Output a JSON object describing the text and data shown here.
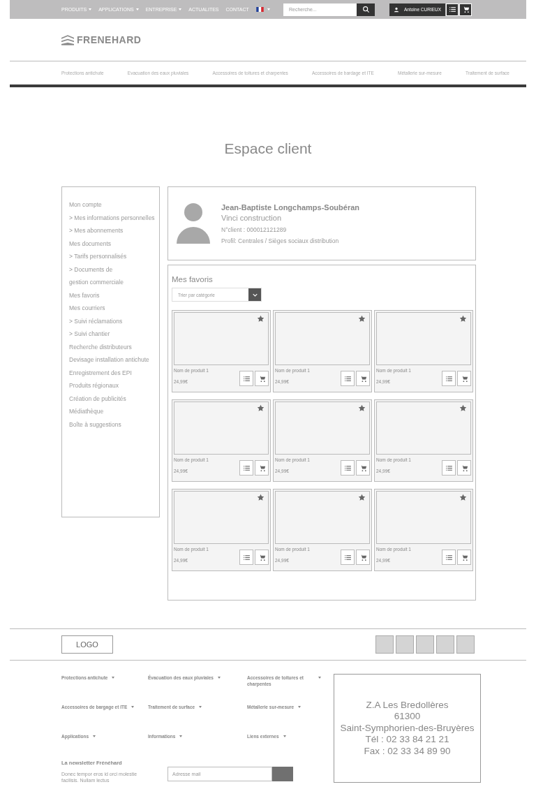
{
  "topbar": {
    "nav": [
      {
        "label": "PRODUITS",
        "dropdown": true
      },
      {
        "label": "APPLICATIONS",
        "dropdown": true
      },
      {
        "label": "ENTREPRISE",
        "dropdown": true
      },
      {
        "label": "ACTUALITES",
        "dropdown": false
      },
      {
        "label": "CONTACT",
        "dropdown": false
      }
    ],
    "search": {
      "placeholder": "Recherche..."
    },
    "user": {
      "name": "Antoine CURIEUX"
    }
  },
  "logo": {
    "text": "FRENEHARD"
  },
  "categories": [
    "Protections antichute",
    "Evacuation des eaux pluviales",
    "Accessoires de toitures et charpentes",
    "Accessoires de bardage et ITE",
    "Métallerie sur-mesure",
    "Traitement de surface"
  ],
  "page_title": "Espace client",
  "sidebar": {
    "items": [
      "Mon compte",
      "> Mes informations personnelles",
      "> Mes abonnements",
      "Mes documents",
      "> Tarifs personnalisés",
      "> Documents de",
      " gestion commerciale",
      "Mes favoris",
      "Mes courriers",
      "> Suivi réclamations",
      "> Suivi chantier",
      "Recherche distributeurs",
      "Devisage installation antichute",
      "Enregistrement des EPI",
      "Produits régionaux",
      "Création de publicités",
      "Médiathèque",
      "Boîte à suggestions"
    ]
  },
  "profile": {
    "name": "Jean-Baptiste Longchamps-Soubéran",
    "company": "Vinci construction",
    "client_number": "N°client : 000012121289",
    "profile": "Profil: Centrales / Sièges sociaux distribution"
  },
  "favorites": {
    "title": "Mes favoris",
    "sort": {
      "placeholder": "Trier par catégorie"
    },
    "products": [
      {
        "name": "Nom de produit 1",
        "price": "24,99€",
        "favorite": true
      },
      {
        "name": "Nom de produit 1",
        "price": "24,99€",
        "favorite": true
      },
      {
        "name": "Nom de produit 1",
        "price": "24,99€",
        "favorite": true
      },
      {
        "name": "Nom de produit 1",
        "price": "24,99€",
        "favorite": true
      },
      {
        "name": "Nom de produit 1",
        "price": "24,99€",
        "favorite": true
      },
      {
        "name": "Nom de produit 1",
        "price": "24,99€",
        "favorite": true
      },
      {
        "name": "Nom de produit 1",
        "price": "24,99€",
        "favorite": true
      },
      {
        "name": "Nom de produit 1",
        "price": "24,99€",
        "favorite": true
      },
      {
        "name": "Nom de produit 1",
        "price": "24,99€",
        "favorite": true
      }
    ]
  },
  "footer": {
    "logo": "LOGO",
    "links": [
      "Protections antichute",
      "Évacuation des eaux pluviales",
      "Accessoires de toitures et charpentes",
      "Accessoires de bargage et ITE",
      "Traitement de surface",
      "Métallerie sur-mesure",
      "Applications",
      "Informations",
      "Liens externes"
    ],
    "newsletter": {
      "title": "La newsletter Frénéhard",
      "text": "Donec tempor eros id orci molestie facilisis. Nullam lectus",
      "placeholder": "Adresse mail"
    },
    "address": [
      "Z.A Les Bredollères",
      "61300",
      "Saint-Symphorien-des-Bruyères",
      "Tél : 02 33 84 21 21",
      "Fax : 02 33 34 89 90"
    ]
  }
}
